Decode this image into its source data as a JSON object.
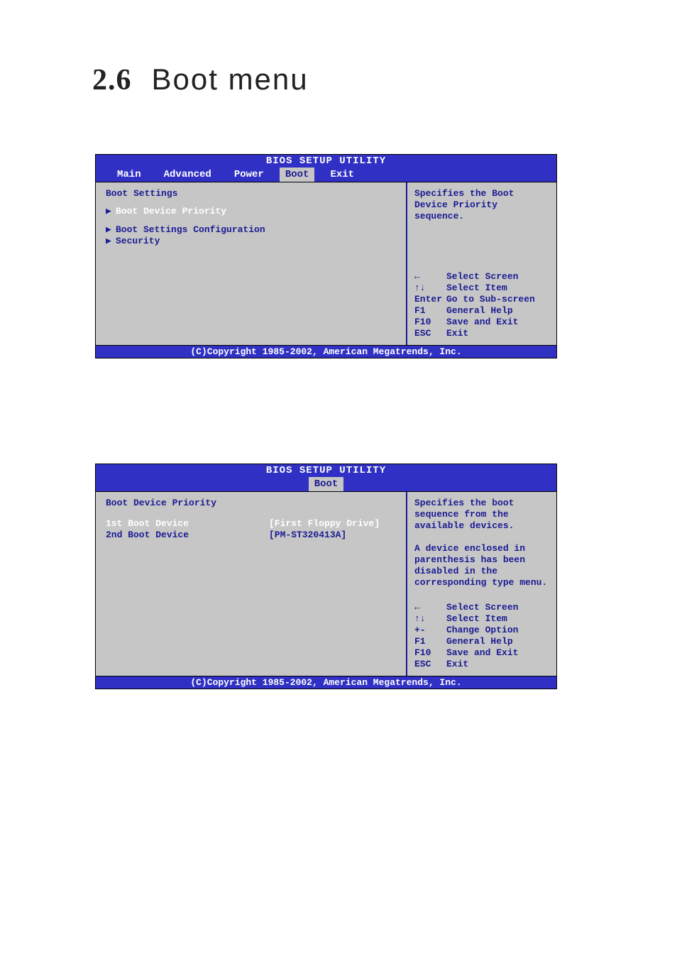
{
  "page_heading": {
    "number": "2.6",
    "text": "Boot menu"
  },
  "bios1": {
    "title": "BIOS SETUP UTILITY",
    "tabs": [
      "Main",
      "Advanced",
      "Power",
      "Boot",
      "Exit"
    ],
    "selected_tab": "Boot",
    "left": {
      "heading": "Boot Settings",
      "items": [
        {
          "arrow": true,
          "label": "Boot Device Priority",
          "selected": true
        },
        {
          "arrow": true,
          "label": "Boot Settings Configuration",
          "selected": false
        },
        {
          "arrow": true,
          "label": "Security",
          "selected": false
        }
      ]
    },
    "help": "Specifies the Boot Device Priority sequence.",
    "nav": [
      {
        "key_icon": "left-arrow",
        "action": "Select Screen"
      },
      {
        "key_icon": "updown",
        "action": "Select Item"
      },
      {
        "key": "Enter",
        "action": "Go to Sub-screen"
      },
      {
        "key": "F1",
        "action": "General Help"
      },
      {
        "key": "F10",
        "action": "Save and Exit"
      },
      {
        "key": "ESC",
        "action": "Exit"
      }
    ],
    "footer": "(C)Copyright 1985-2002, American Megatrends, Inc."
  },
  "bios2": {
    "title": "BIOS SETUP UTILITY",
    "single_tab": "Boot",
    "left": {
      "heading": "Boot Device Priority",
      "rows": [
        {
          "label": "1st Boot Device",
          "value": "[First Floppy Drive]",
          "selected": true
        },
        {
          "label": "2nd Boot Device",
          "value": "[PM-ST320413A]",
          "selected": false
        }
      ]
    },
    "help": "Specifies the boot sequence from the available devices.\n\nA device enclosed in parenthesis has been disabled in the corresponding type menu.",
    "nav": [
      {
        "key_icon": "left-arrow",
        "action": "Select Screen"
      },
      {
        "key_icon": "updown",
        "action": "Select Item"
      },
      {
        "key": "+-",
        "action": "Change Option"
      },
      {
        "key": "F1",
        "action": "General Help"
      },
      {
        "key": "F10",
        "action": "Save and Exit"
      },
      {
        "key": "ESC",
        "action": "Exit"
      }
    ],
    "footer": "(C)Copyright 1985-2002, American Megatrends, Inc."
  }
}
